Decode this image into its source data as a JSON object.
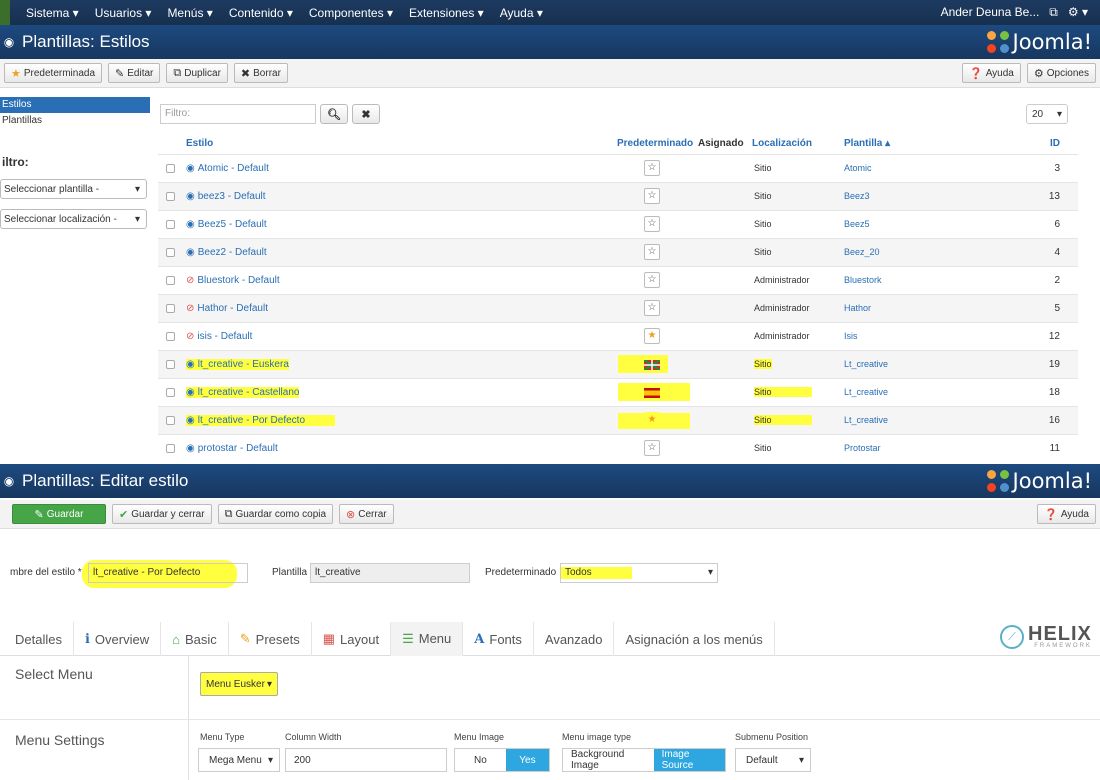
{
  "topnav": {
    "items": [
      "Sistema ▾",
      "Usuarios ▾",
      "Menús ▾",
      "Contenido ▾",
      "Componentes ▾",
      "Extensiones ▾",
      "Ayuda ▾"
    ],
    "user": "Ander Deuna Be...",
    "external_icon": "external-link-icon",
    "gear_icon": "gear-icon"
  },
  "header1": {
    "title": "Plantillas: Estilos",
    "brand": "Joomla!"
  },
  "toolbar1": {
    "default_label": "Predeterminada",
    "edit_label": "Editar",
    "duplicate_label": "Duplicar",
    "delete_label": "Borrar",
    "help_label": "Ayuda",
    "options_label": "Opciones"
  },
  "sidebar": {
    "items": [
      "Estilos",
      "Plantillas"
    ],
    "filter_title": "iltro:",
    "template_select": "Seleccionar plantilla -",
    "location_select": "Seleccionar localización -"
  },
  "search": {
    "placeholder": "Filtro:"
  },
  "pager": {
    "value": "20"
  },
  "table": {
    "headers": {
      "style": "Estilo",
      "default": "Predeterminado",
      "assigned": "Asignado",
      "location": "Localización",
      "template": "Plantilla ▴",
      "id": "ID"
    },
    "rows": [
      {
        "name": "Atomic - Default",
        "location": "Sitio",
        "template": "Atomic",
        "id": "3"
      },
      {
        "name": "beez3 - Default",
        "location": "Sitio",
        "template": "Beez3",
        "id": "13"
      },
      {
        "name": "Beez5 - Default",
        "location": "Sitio",
        "template": "Beez5",
        "id": "6"
      },
      {
        "name": "Beez2 - Default",
        "location": "Sitio",
        "template": "Beez_20",
        "id": "4"
      },
      {
        "name": "Bluestork - Default",
        "location": "Administrador",
        "template": "Bluestork",
        "id": "2"
      },
      {
        "name": "Hathor - Default",
        "location": "Administrador",
        "template": "Hathor",
        "id": "5"
      },
      {
        "name": "isis - Default",
        "location": "Administrador",
        "template": "Isis",
        "id": "12"
      },
      {
        "name": "lt_creative - Euskera",
        "location": "Sitio",
        "template": "Lt_creative",
        "id": "19"
      },
      {
        "name": "lt_creative - Castellano",
        "location": "Sitio",
        "template": "Lt_creative",
        "id": "18"
      },
      {
        "name": "lt_creative - Por Defecto",
        "location": "Sitio",
        "template": "Lt_creative",
        "id": "16"
      },
      {
        "name": "protostar - Default",
        "location": "Sitio",
        "template": "Protostar",
        "id": "11"
      }
    ],
    "highlight_color": "#ffff40"
  },
  "header2": {
    "title": "Plantillas: Editar estilo",
    "brand": "Joomla!"
  },
  "toolbar2": {
    "save_label": "Guardar",
    "save_close_label": "Guardar y cerrar",
    "save_copy_label": "Guardar como copia",
    "close_label": "Cerrar",
    "help_label": "Ayuda"
  },
  "form": {
    "style_name_label": "mbre del estilo *",
    "style_name_value": "lt_creative - Por Defecto",
    "template_label": "Plantilla",
    "template_value": "lt_creative",
    "default_label": "Predeterminado",
    "default_value": "Todos"
  },
  "tabs": [
    "Detalles",
    "Overview",
    "Basic",
    "Presets",
    "Layout",
    "Menu",
    "Fonts",
    "Avanzado",
    "Asignación a los menús"
  ],
  "helix": {
    "name": "HELIX",
    "sub": "FRAMEWORK"
  },
  "menu_section": {
    "select_label": "Select Menu",
    "select_value": "Menu Eusker",
    "settings_label": "Menu Settings",
    "menu_type_label": "Menu Type",
    "menu_type_value": "Mega Menu",
    "column_width_label": "Column Width",
    "column_width_value": "200",
    "menu_image_label": "Menu Image",
    "menu_image_no": "No",
    "menu_image_yes": "Yes",
    "image_type_label": "Menu image type",
    "image_type_bg": "Background Image",
    "image_type_src": "Image Source",
    "submenu_label": "Submenu Position",
    "submenu_value": "Default"
  }
}
